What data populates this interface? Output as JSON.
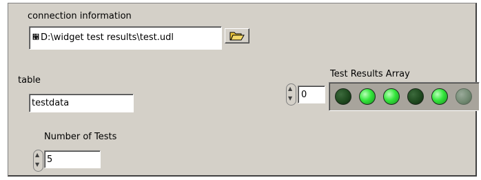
{
  "connection": {
    "label": "connection information",
    "path": "D:\\widget test results\\test.udl",
    "path_prefix": "੡",
    "browse_icon": "folder-open-icon"
  },
  "table": {
    "label": "table",
    "value": "testdata"
  },
  "tests": {
    "label": "Number of Tests",
    "value": "5"
  },
  "results": {
    "label": "Test Results Array",
    "index": "0",
    "leds": [
      {
        "state": "off",
        "color": "#1f4a1f"
      },
      {
        "state": "on",
        "color": "#33e63b"
      },
      {
        "state": "on",
        "color": "#33e63b"
      },
      {
        "state": "off",
        "color": "#1f4a1f"
      },
      {
        "state": "on",
        "color": "#33e63b"
      },
      {
        "state": "disabled",
        "color": "#6f876f"
      }
    ]
  },
  "colors": {
    "panel": "#d4d0c8",
    "led_on": "#33e63b",
    "led_off": "#1f4a1f"
  }
}
